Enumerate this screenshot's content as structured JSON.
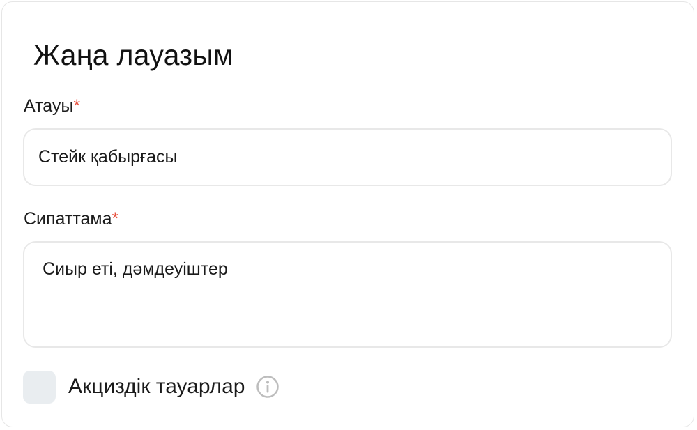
{
  "form": {
    "title": "Жаңа лауазым",
    "name_field": {
      "label": "Атауы",
      "required_mark": "*",
      "value": "Стейк қабырғасы"
    },
    "description_field": {
      "label": "Сипаттама",
      "required_mark": "*",
      "value": "Сиыр еті, дәмдеуіштер"
    },
    "excise_checkbox": {
      "label": "Акциздік тауарлар",
      "checked": false,
      "info_icon": "info-icon"
    }
  },
  "colors": {
    "required": "#e8513f",
    "checkbox_bg": "#e9edf0",
    "border": "#e8e8e8",
    "info_icon": "#bdbdbd"
  }
}
